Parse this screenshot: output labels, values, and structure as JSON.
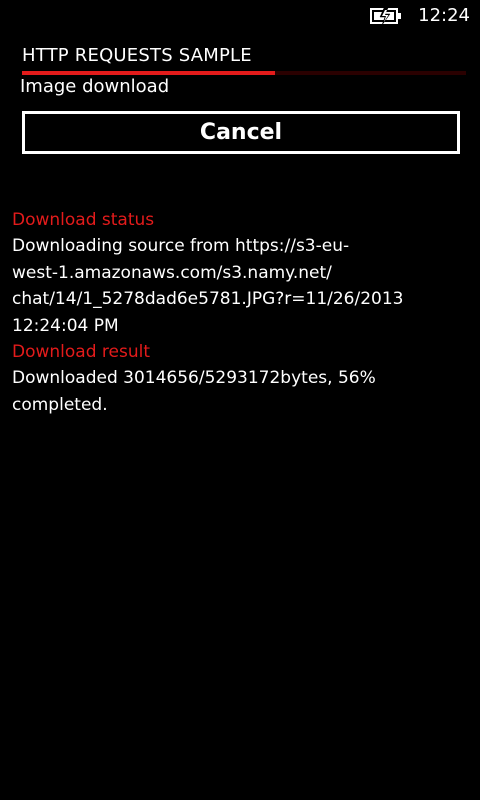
{
  "status_bar": {
    "battery_icon": "battery-charging-icon",
    "time": "12:24"
  },
  "header": {
    "title": "HTTP REQUESTS SAMPLE",
    "subtitle": "Image download",
    "progress_fraction": 0.57,
    "accent_color": "#e31b1b"
  },
  "actions": {
    "cancel_label": "Cancel"
  },
  "download_status": {
    "label": "Download status",
    "lines": [
      "Downloading source from https://s3-eu-",
      "west-1.amazonaws.com/s3.namy.net/",
      "chat/14/1_5278dad6e5781.JPG?r=11/26/2013",
      "12:24:04 PM"
    ]
  },
  "download_result": {
    "label": "Download result",
    "lines": [
      "Downloaded 3014656/5293172bytes, 56%",
      "completed."
    ]
  }
}
